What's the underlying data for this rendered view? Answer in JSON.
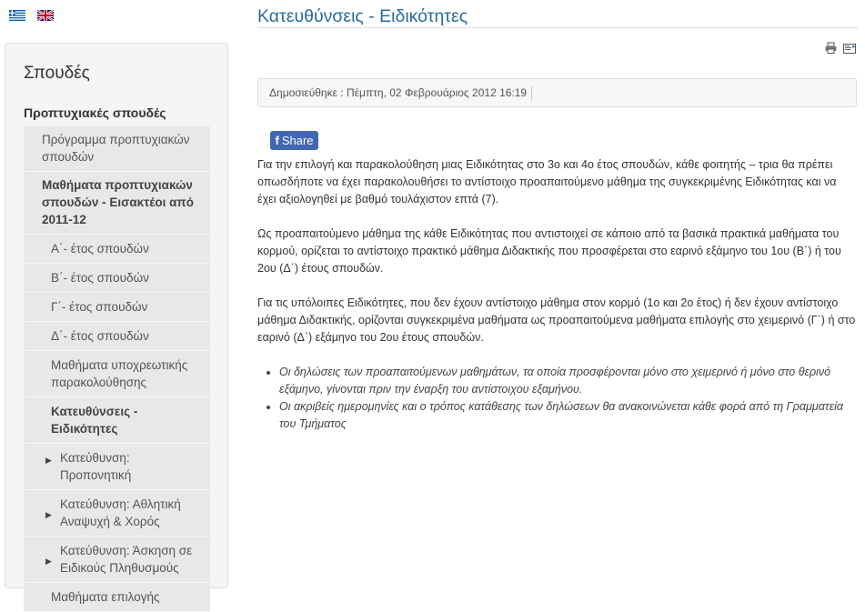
{
  "languages": [
    {
      "name": "greek-flag-icon",
      "label": "Ελληνικά"
    },
    {
      "name": "uk-flag-icon",
      "label": "English"
    }
  ],
  "sidebar": {
    "title": "Σπουδές",
    "section": "Προπτυχιακές σπουδές",
    "items": [
      {
        "label": "Πρόγραμμα προπτυχιακών σπουδών",
        "level": 1,
        "bold": false
      },
      {
        "label": "Μαθήματα προπτυχιακών σπουδών - Εισακτέοι από 2011-12",
        "level": 1,
        "bold": true
      },
      {
        "label": "Α΄- έτος σπουδών",
        "level": 2,
        "bold": false
      },
      {
        "label": "Β΄- έτος σπουδών",
        "level": 2,
        "bold": false
      },
      {
        "label": "Γ΄- έτος σπουδών",
        "level": 2,
        "bold": false
      },
      {
        "label": "Δ΄- έτος σπουδών",
        "level": 2,
        "bold": false
      },
      {
        "label": "Μαθήματα υποχρεωτικής παρακολούθησης",
        "level": 2,
        "bold": false
      },
      {
        "label": "Κατευθύνσεις - Ειδικότητες",
        "level": 2,
        "bold": true
      },
      {
        "label": "Κατεύθυνση: Προπονητική",
        "level": 3,
        "bold": false
      },
      {
        "label": "Κατεύθυνση: Αθλητική Αναψυχή & Χορός",
        "level": 3,
        "bold": false
      },
      {
        "label": "Κατεύθυνση: Άσκηση σε Ειδικούς Πληθυσμούς",
        "level": 3,
        "bold": false
      },
      {
        "label": "Μαθήματα επιλογής",
        "level": 2,
        "bold": false
      }
    ]
  },
  "main": {
    "title": "Κατευθύνσεις - Ειδικότητες",
    "published": "Δημοσιεύθηκε : Πέμπτη, 02 Φεβρουάριος 2012 16:19",
    "share": {
      "icon": "f",
      "label": "Share"
    },
    "paragraphs": [
      "Για την επιλογή και παρακολούθηση μιας Ειδικότητας στο 3ο και 4ο έτος σπουδών, κάθε φοιτητής – τρια θα πρέπει οπωσδήποτε να έχει παρακολουθήσει το αντίστοιχο προαπαιτούμενο μάθημα της συγκεκριμένης Ειδικότητας και να έχει αξιολογηθεί με βαθμό τουλάχιστον επτά (7).",
      "Ως προαπαιτούμενο μάθημα της κάθε Ειδικότητας που αντιστοιχεί σε κάποιο από τα βασικά πρακτικά μαθήματα του κορμού, ορίζεται το αντίστοιχο πρακτικό μάθημα Διδακτικής που προσφέρεται στο εαρινό εξάμηνο του 1ου (Β΄) ή του 2ου (Δ΄) έτους σπουδών.",
      "Για τις υπόλοιπες Ειδικότητες, που δεν έχουν αντίστοιχο μάθημα στον κορμό (1ο και 2ο έτος) ή δεν έχουν αντίστοιχο μάθημα Διδακτικής, ορίζονται συγκεκριμένα μαθήματα ως προαπαιτούμενα μαθήματα επιλογής στο χειμερινό (Γ΄) ή στο εαρινό (Δ΄) εξάμηνο του 2ου έτους σπουδών."
    ],
    "bullets": [
      "Οι δηλώσεις των προαπαιτούμενων μαθημάτων, τα οποία προσφέρονται μόνο στο χειμερινό ή μόνο στο θερινό εξάμηνο, γίνονται πριν την έναρξη του αντίστοιχου εξαμήνου.",
      "Οι ακριβείς ημερομηνίες και ο τρόπος κατάθεσης των δηλώσεων θα ανακοινώνεται κάθε φορά από τη Γραμματεία του Τμήματος"
    ]
  },
  "toolbar": [
    {
      "name": "print-icon"
    },
    {
      "name": "email-icon"
    }
  ],
  "colors": {
    "title": "#2a6a9e",
    "sidebar_bg": "#f5f5f5",
    "menu_bg": "#e8e8e8",
    "share_bg": "#4267b2"
  }
}
